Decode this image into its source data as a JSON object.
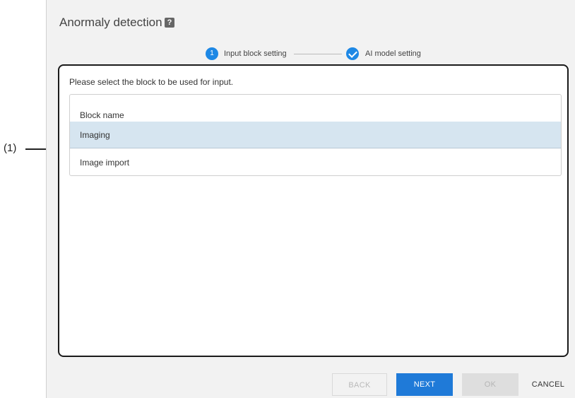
{
  "callout": {
    "label": "(1)"
  },
  "dialog": {
    "title": "Anormaly detection",
    "help_icon": "?",
    "steps": [
      {
        "number": "1",
        "label": "Input block setting",
        "state": "active"
      },
      {
        "label": "AI model setting",
        "state": "completed",
        "icon": "check-icon"
      }
    ],
    "instruction": "Please select the block to be used for input.",
    "table": {
      "header": "Block name",
      "rows": [
        {
          "name": "Imaging",
          "selected": true
        },
        {
          "name": "Image import",
          "selected": false
        }
      ]
    },
    "buttons": {
      "back": "BACK",
      "next": "NEXT",
      "ok": "OK",
      "cancel": "CANCEL"
    }
  },
  "colors": {
    "accent": "#1f7ad8",
    "selected_row": "#d6e5f0",
    "dialog_bg": "#f2f2f2"
  }
}
